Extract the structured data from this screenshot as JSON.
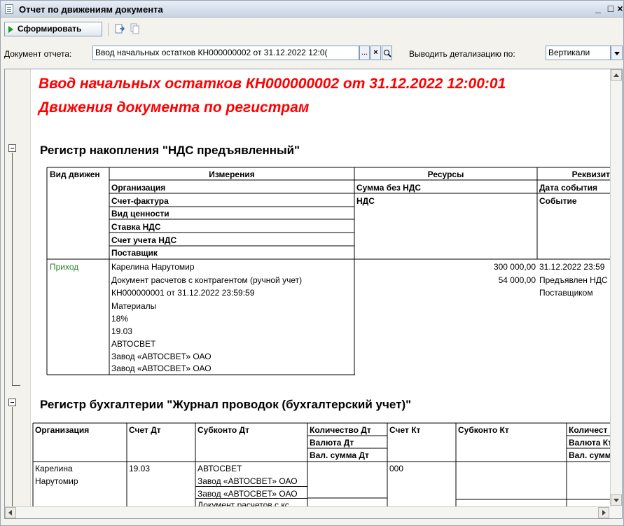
{
  "window": {
    "title": "Отчет по движениям документа",
    "controls": {
      "minimize": "_",
      "maximize": "□",
      "close": "×"
    }
  },
  "toolbar": {
    "generate_label": "Сформировать",
    "icons": [
      "generate-play-icon",
      "export-icon",
      "copy-icon"
    ]
  },
  "filters": {
    "document_label": "Документ отчета:",
    "document_value": "Ввод начальных остатков КН000000002 от 31.12.2022 12:0(",
    "ellipsis": "...",
    "clear": "×",
    "search": "Q",
    "detail_label": "Выводить детализацию по:",
    "detail_value": "Вертикали"
  },
  "report": {
    "title_line1": "Ввод начальных остатков КН000000002 от 31.12.2022 12:00:01",
    "title_line2": "Движения документа по регистрам",
    "register1": {
      "title": "Регистр накопления \"НДС предъявленный\"",
      "headers": {
        "movement": "Вид движен",
        "dimensions": "Измерения",
        "resources": "Ресурсы",
        "requisites": "Реквизит"
      },
      "dim_fields": [
        "Организация",
        "Счет-фактура",
        "Вид ценности",
        "Ставка НДС",
        "Счет учета НДС",
        "Поставщик"
      ],
      "res_fields": [
        "Сумма без НДС",
        "НДС"
      ],
      "req_fields": [
        "Дата события",
        "Событие"
      ],
      "row": {
        "movement": "Приход",
        "dimensions": [
          "Карелина Нарутомир",
          "Документ расчетов с контрагентом (ручной учет)",
          "КН000000001 от 31.12.2022 23:59:59",
          "Материалы",
          "18%",
          "19.03",
          "АВТОСВЕТ",
          "Завод «АВТОСВЕТ» ОАО",
          "Завод «АВТОСВЕТ» ОАО"
        ],
        "resources": [
          "300 000,00",
          "54 000,00"
        ],
        "requisites": [
          "31.12.2022 23:59",
          "Предъявлен НДС",
          "Поставщиком"
        ]
      }
    },
    "register2": {
      "title": "Регистр бухгалтерии \"Журнал проводок (бухгалтерский учет)\"",
      "headers": {
        "org": "Организация",
        "debit_account": "Счет Дт",
        "debit_subconto": "Субконто Дт",
        "qty_dt": "Количество Дт",
        "cur_dt": "Валюта Дт",
        "cursum_dt": "Вал. сумма Дт",
        "credit_account": "Счет Кт",
        "credit_subconto": "Субконто Кт",
        "qty_kt": "Количест",
        "cur_kt": "Валюта Кт",
        "cursum_kt": "Вал. сумм"
      },
      "row": {
        "org": [
          "Карелина",
          "Нарутомир"
        ],
        "debit_account": "19.03",
        "debit_subconto": [
          "АВТОСВЕТ",
          "Завод «АВТОСВЕТ» ОАО",
          "Завод «АВТОСВЕТ» ОАО",
          "Документ расчетов с кс"
        ],
        "credit_account": "000"
      }
    }
  }
}
